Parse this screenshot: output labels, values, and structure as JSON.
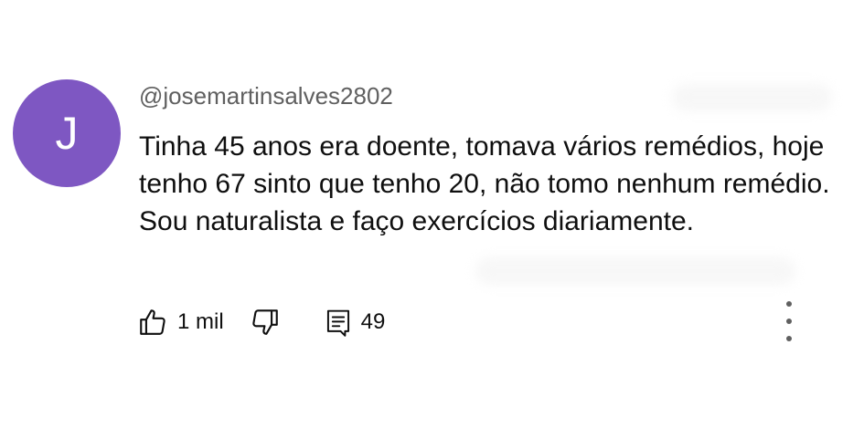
{
  "comment": {
    "author": "@josemartinsalves2802",
    "avatar_letter": "J",
    "avatar_color": "#7e57c2",
    "text": "Tinha 45 anos era doente, tomava vários remédios, hoje tenho 67 sinto que tenho 20, não tomo nenhum remédio. Sou naturalista e faço exercícios diariamente.",
    "actions": {
      "like_icon": "thumbs-up-icon",
      "like_count": "1 mil",
      "dislike_icon": "thumbs-down-icon",
      "reply_icon": "comment-icon",
      "reply_count": "49",
      "menu_icon": "more-vert-icon"
    }
  }
}
